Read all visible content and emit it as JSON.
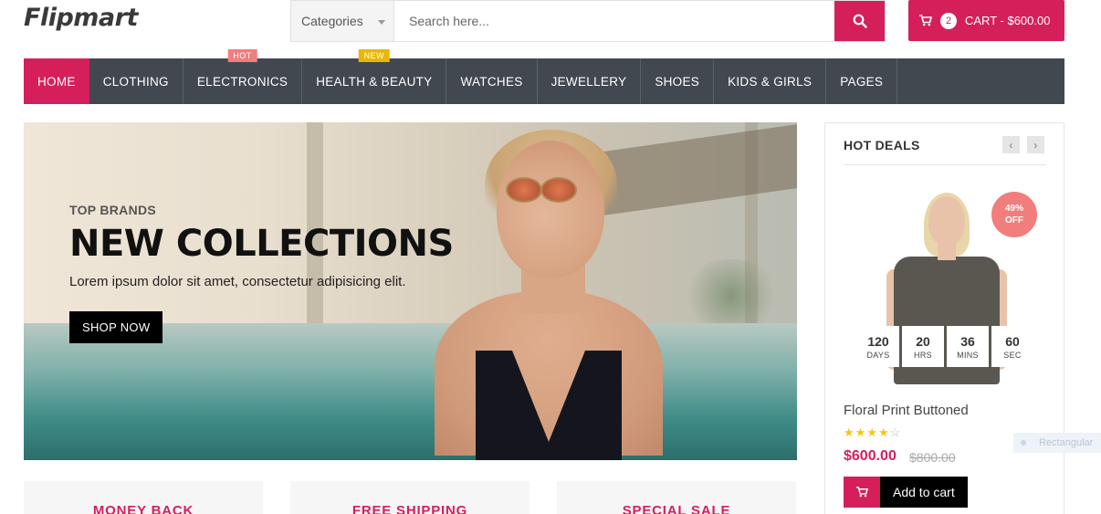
{
  "brand": {
    "logo": "Flipmart"
  },
  "search": {
    "category_label": "Categories",
    "placeholder": "Search here..."
  },
  "cart": {
    "count": "2",
    "label": "CART - $600.00"
  },
  "nav": {
    "items": [
      {
        "label": "HOME",
        "active": true
      },
      {
        "label": "CLOTHING"
      },
      {
        "label": "ELECTRONICS",
        "tag": "HOT"
      },
      {
        "label": "HEALTH & BEAUTY",
        "tag": "NEW"
      },
      {
        "label": "WATCHES"
      },
      {
        "label": "JEWELLERY"
      },
      {
        "label": "SHOES"
      },
      {
        "label": "KIDS & GIRLS"
      },
      {
        "label": "PAGES"
      }
    ]
  },
  "hero": {
    "kicker": "TOP BRANDS",
    "title": "NEW COLLECTIONS",
    "subtitle": "Lorem ipsum dolor sit amet, consectetur adipisicing elit.",
    "button": "SHOP NOW"
  },
  "hot_deals": {
    "title": "HOT DEALS",
    "discount_pct": "49%",
    "discount_word": "OFF",
    "countdown": [
      {
        "value": "120",
        "unit": "DAYS"
      },
      {
        "value": "20",
        "unit": "HRS"
      },
      {
        "value": "36",
        "unit": "MINS"
      },
      {
        "value": "60",
        "unit": "SEC"
      }
    ],
    "product_name": "Floral Print Buttoned",
    "rating": 4,
    "rating_max": 5,
    "price": "$600.00",
    "old_price": "$800.00",
    "add_to_cart": "Add to cart"
  },
  "overlay": {
    "ghost_label": "Rectangular"
  },
  "info_boxes": [
    "MONEY BACK",
    "FREE SHIPPING",
    "SPECIAL SALE"
  ],
  "colors": {
    "accent": "#d51f5b",
    "nav_bg": "#424850",
    "hot_tag": "#f27d7d",
    "new_tag": "#e8b800"
  }
}
